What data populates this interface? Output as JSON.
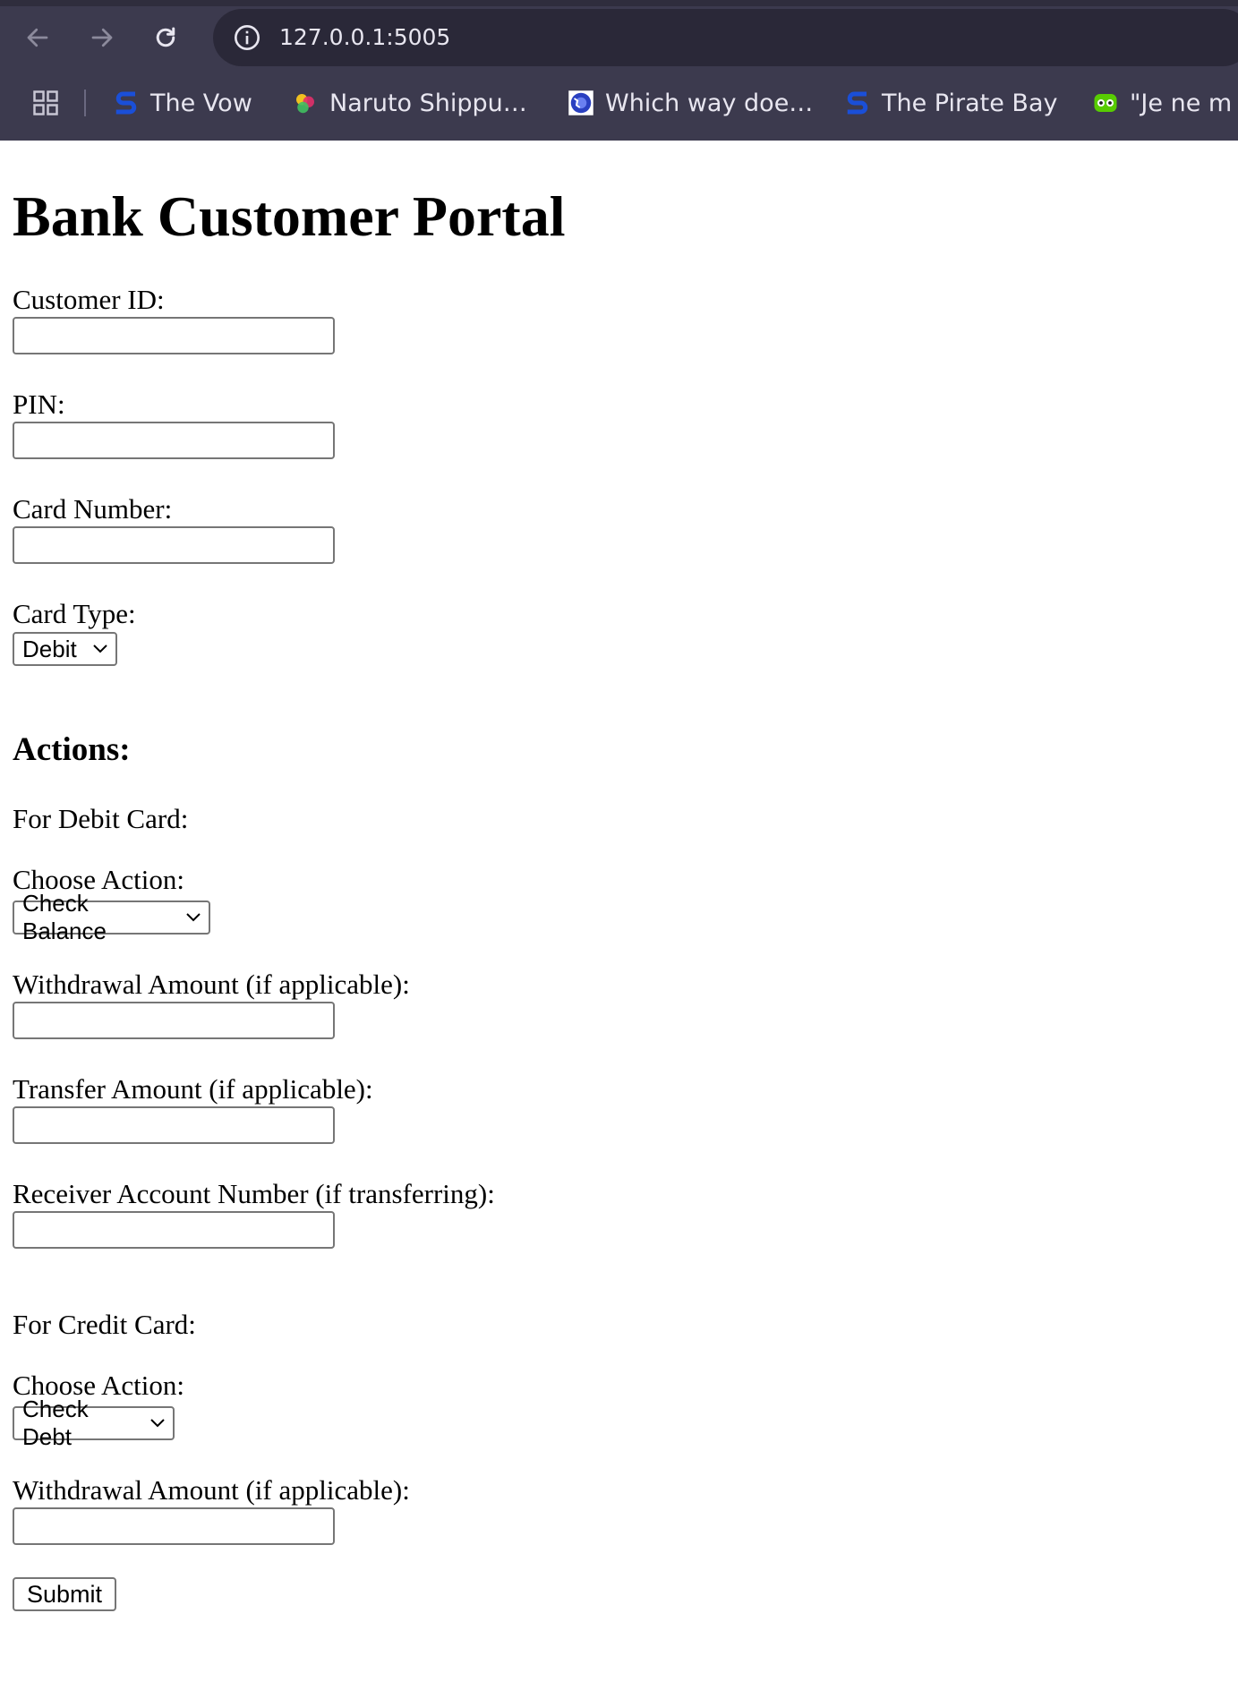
{
  "browser": {
    "url": "127.0.0.1:5005",
    "bookmarks": [
      {
        "label": "The Vow",
        "icon": "s-logo-icon"
      },
      {
        "label": "Naruto Shippu…",
        "icon": "colorful-logo-icon"
      },
      {
        "label": "Which way doe…",
        "icon": "globe-icon"
      },
      {
        "label": "The Pirate Bay",
        "icon": "s-logo-icon"
      },
      {
        "label": "\"Je ne m",
        "icon": "owl-icon"
      }
    ],
    "colors": {
      "chrome_bg": "#3c3a4e",
      "omnibox_bg": "#2a2838",
      "s_logo": "#1a4fd8"
    }
  },
  "page": {
    "title": "Bank Customer Portal",
    "customer_id_label": "Customer ID:",
    "customer_id_value": "",
    "pin_label": "PIN:",
    "pin_value": "",
    "card_number_label": "Card Number:",
    "card_number_value": "",
    "card_type_label": "Card Type:",
    "card_type_selected": "Debit",
    "actions_heading": "Actions:",
    "debit": {
      "heading": "For Debit Card:",
      "choose_action_label": "Choose Action:",
      "action_selected": "Check Balance",
      "withdrawal_label": "Withdrawal Amount (if applicable):",
      "withdrawal_value": "",
      "transfer_label": "Transfer Amount (if applicable):",
      "transfer_value": "",
      "receiver_label": "Receiver Account Number (if transferring):",
      "receiver_value": ""
    },
    "credit": {
      "heading": "For Credit Card:",
      "choose_action_label": "Choose Action:",
      "action_selected": "Check Debt",
      "withdrawal_label": "Withdrawal Amount (if applicable):",
      "withdrawal_value": ""
    },
    "submit_label": "Submit"
  }
}
